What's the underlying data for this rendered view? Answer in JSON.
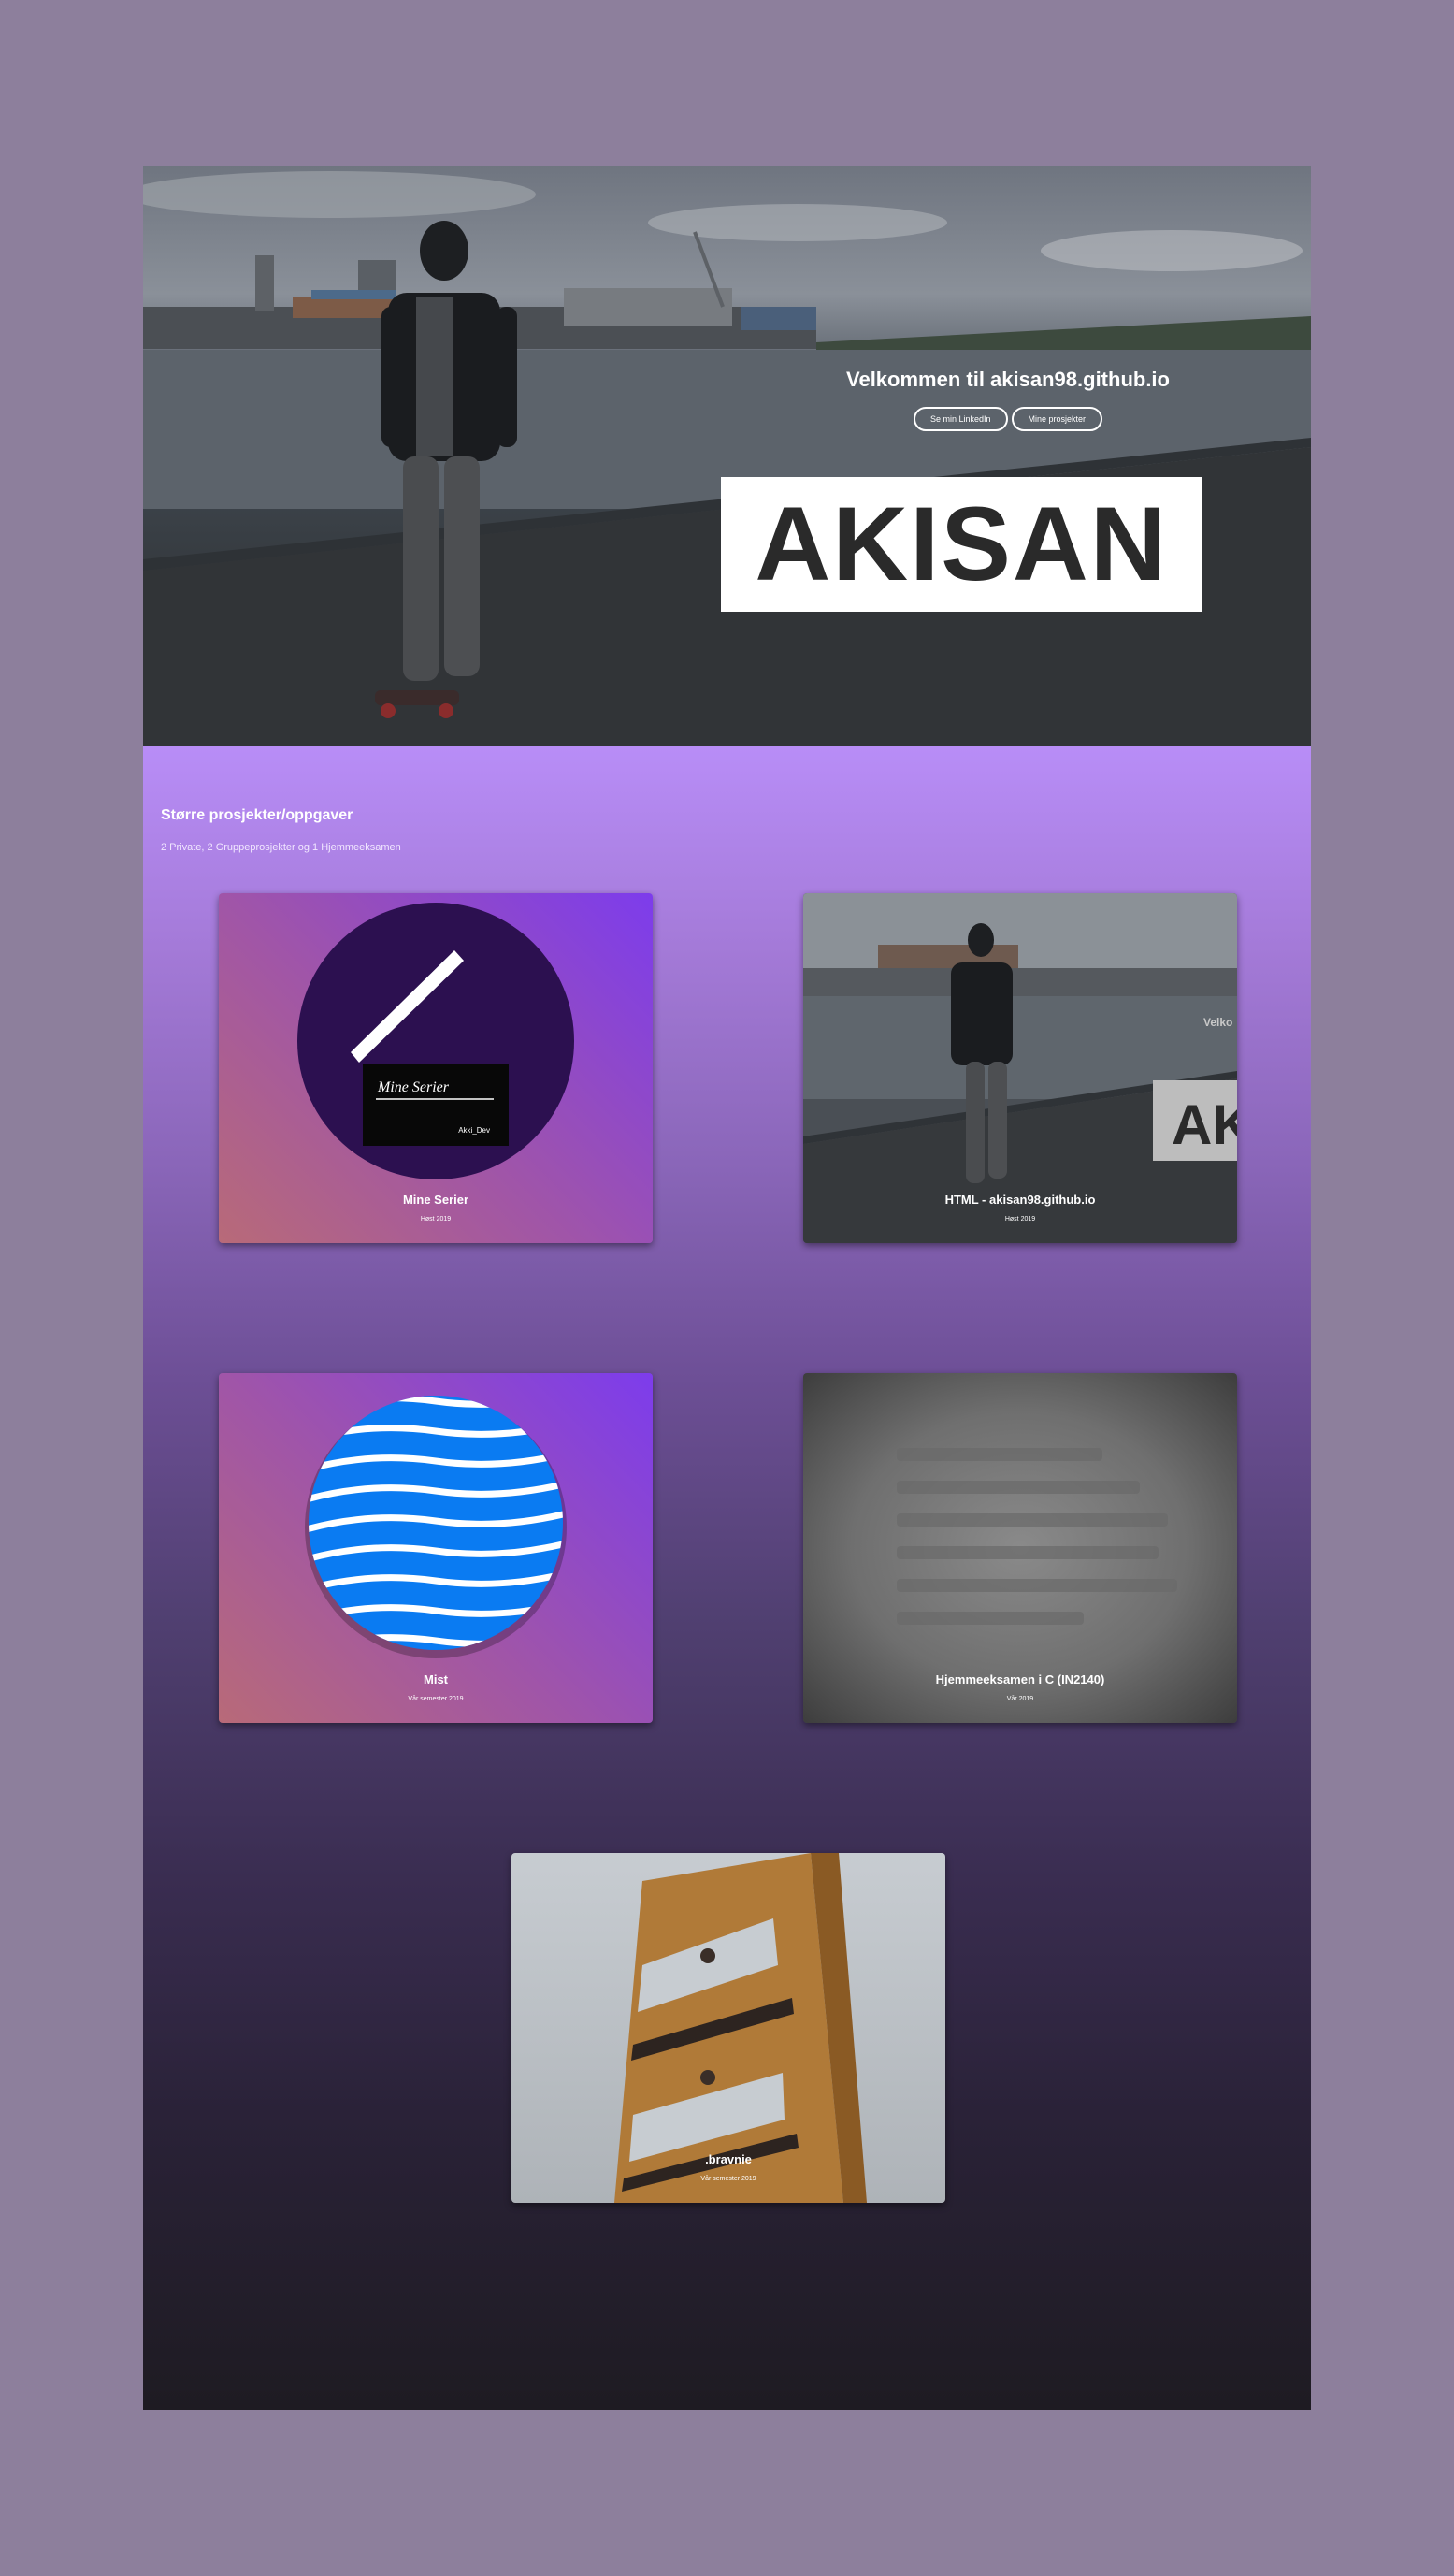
{
  "hero": {
    "title": "Velkommen til akisan98.github.io",
    "button_linkedin": "Se min LinkedIn",
    "button_projects": "Mine prosjekter",
    "logo": "AKISAN"
  },
  "section": {
    "title": "Større prosjekter/oppgaver",
    "subtitle": "2 Private, 2 Gruppeprosjekter og 1 Hjemmeeksamen"
  },
  "cards": [
    {
      "title": "Mine Serier",
      "date": "Høst 2019",
      "logo_title": "Mine Serier",
      "logo_author": "Akki_Dev"
    },
    {
      "title": "HTML - akisan98.github.io",
      "date": "Høst 2019",
      "thumb_text": "Velko",
      "thumb_logo": "AK"
    },
    {
      "title": "Mist",
      "date": "Vår semester 2019"
    },
    {
      "title": "Hjemmeeksamen i C (IN2140)",
      "date": "Vår 2019"
    },
    {
      "title": ".bravnie",
      "date": "Vår semester 2019"
    }
  ],
  "colors": {
    "background": "#8d7f9c",
    "accent_purple": "#7d3cec",
    "mist_blue": "#0a7bf2"
  }
}
